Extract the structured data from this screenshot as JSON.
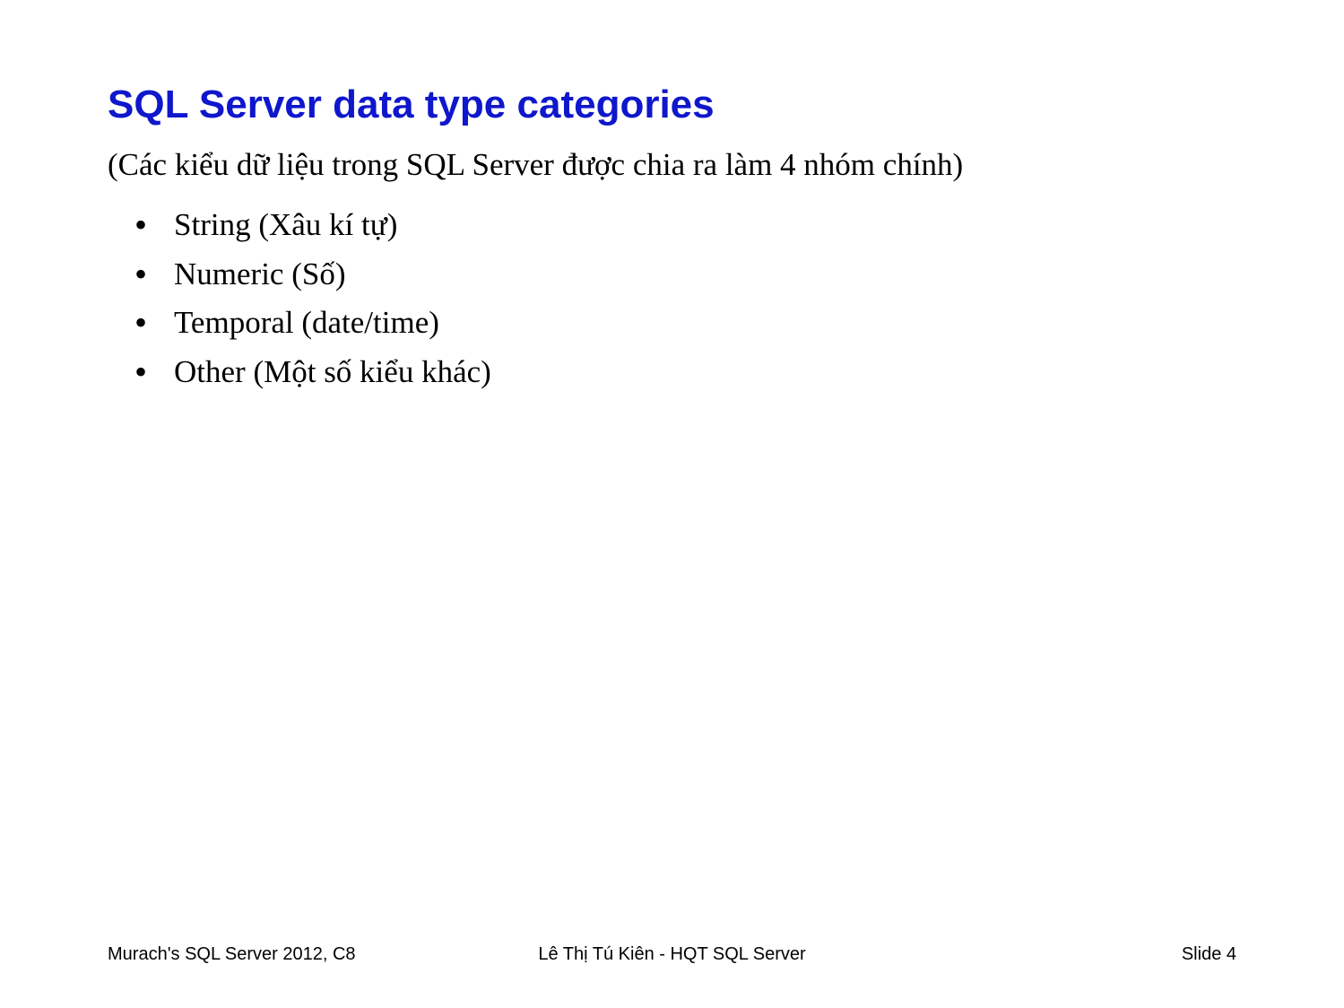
{
  "slide": {
    "title": "SQL Server data type categories",
    "subtitle": "(Các kiểu dữ liệu trong SQL Server được chia ra làm 4 nhóm chính)",
    "bullets": [
      "String (Xâu kí tự)",
      "Numeric (Số)",
      "Temporal (date/time)",
      "Other (Một số kiểu khác)"
    ]
  },
  "footer": {
    "left": "Murach's SQL Server 2012, C8",
    "center": "Lê Thị Tú Kiên - HQT SQL Server",
    "right": "Slide 4"
  }
}
